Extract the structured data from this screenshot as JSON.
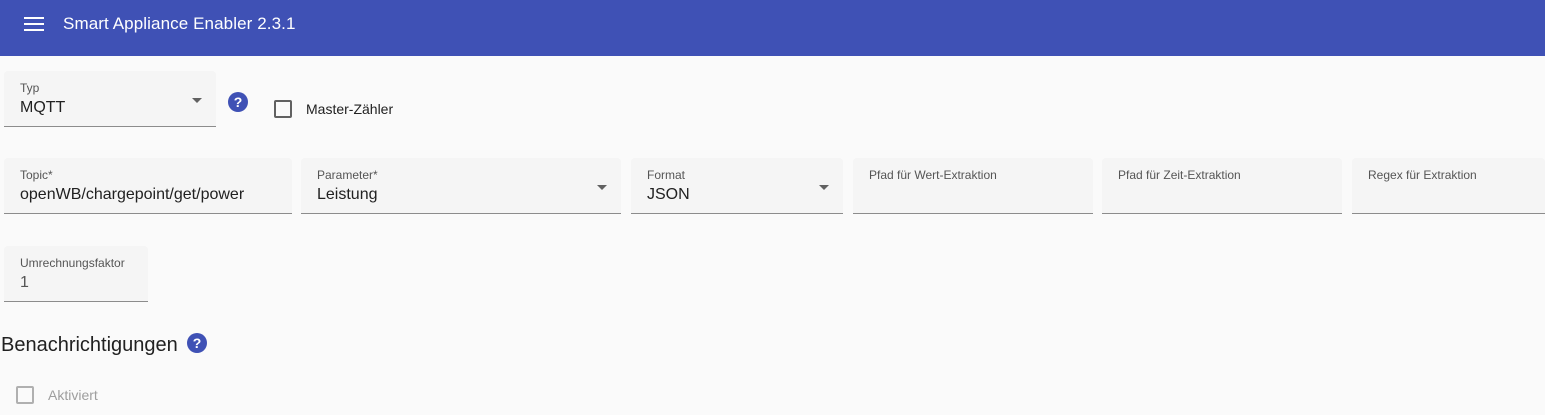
{
  "header": {
    "title": "Smart Appliance Enabler 2.3.1",
    "menu_icon": "menu-icon"
  },
  "meter": {
    "type_label": "Typ",
    "type_value": "MQTT",
    "master_label": "Master-Zähler",
    "topic_label": "Topic*",
    "topic_value": "openWB/chargepoint/get/power",
    "parameter_label": "Parameter*",
    "parameter_value": "Leistung",
    "format_label": "Format",
    "format_value": "JSON",
    "value_path_label": "Pfad für Wert-Extraktion",
    "value_path_value": "",
    "time_path_label": "Pfad für Zeit-Extraktion",
    "time_path_value": "",
    "regex_label": "Regex für Extraktion",
    "regex_value": "",
    "factor_label": "Umrechnungsfaktor",
    "factor_value": "1"
  },
  "notifications": {
    "heading": "Benachrichtigungen",
    "enabled_label": "Aktiviert"
  },
  "colors": {
    "primary": "#3f51b5",
    "background": "#fafafa"
  }
}
